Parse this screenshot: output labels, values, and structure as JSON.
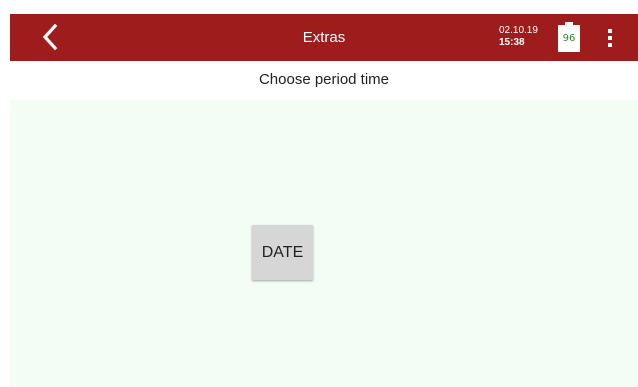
{
  "app_bar": {
    "title": "Extras",
    "date": "02.10.19",
    "time": "15:38",
    "battery_level": "96",
    "icons": {
      "back": "chevron-left-icon",
      "battery": "battery-icon",
      "menu": "more-vertical-icon"
    },
    "colors": {
      "background": "#9e1c1c",
      "foreground": "#ffffff",
      "battery_text": "#2e8b2e"
    }
  },
  "page": {
    "subtitle": "Choose period time",
    "background": "#f3fdf5"
  },
  "buttons": {
    "date_label": "DATE"
  }
}
